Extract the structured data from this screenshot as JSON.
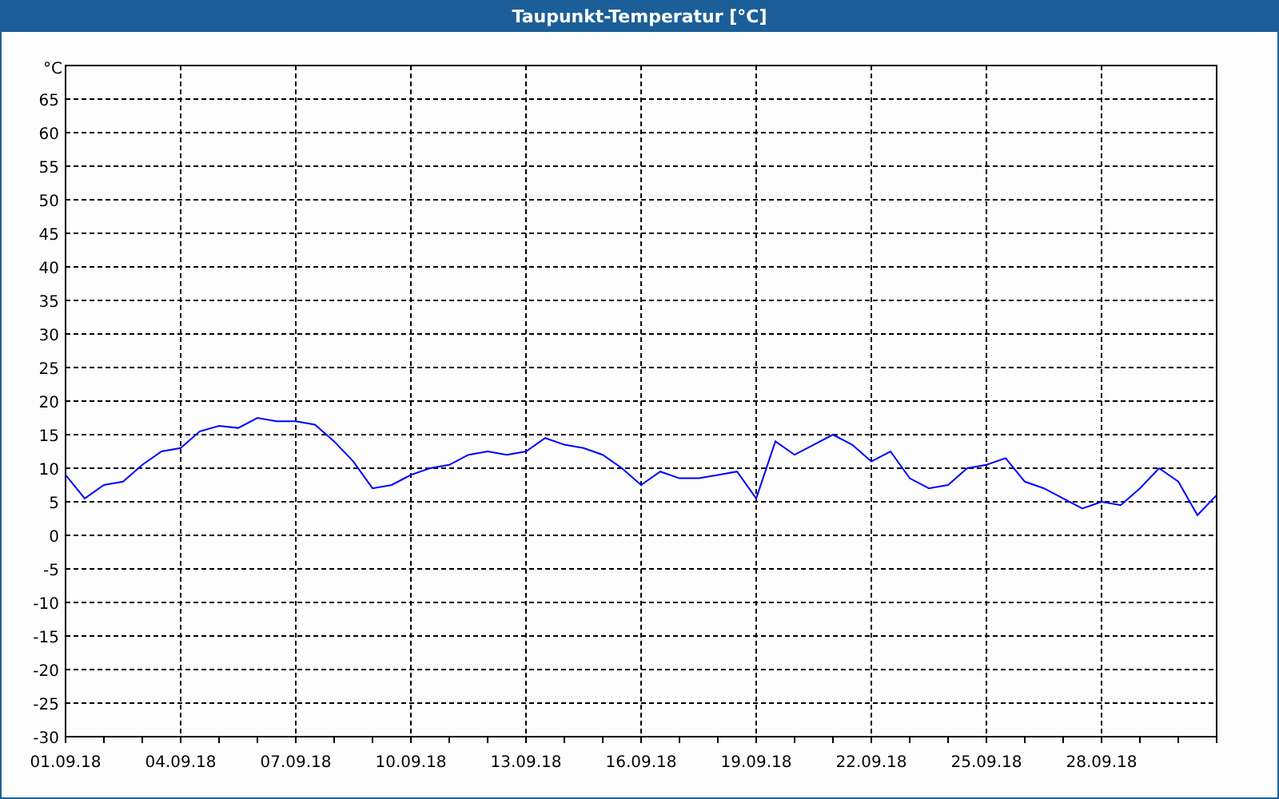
{
  "window": {
    "title": "Taupunkt-Temperatur [°C]"
  },
  "chart": {
    "chart_data": {
      "type": "line",
      "grid": true,
      "ylabel": "°C",
      "ylim": [
        -30,
        70
      ],
      "categories": [
        "01.09.18",
        null,
        null,
        null,
        null,
        null,
        "04.09.18",
        null,
        null,
        null,
        null,
        null,
        "07.09.18",
        null,
        null,
        null,
        null,
        null,
        "10.09.18",
        null,
        null,
        null,
        null,
        null,
        "13.09.18",
        null,
        null,
        null,
        null,
        null,
        "16.09.18",
        null,
        null,
        null,
        null,
        null,
        "19.09.18",
        null,
        null,
        null,
        null,
        null,
        "22.09.18",
        null,
        null,
        null,
        null,
        null,
        "25.09.18",
        null,
        null,
        null,
        null,
        null,
        "28.09.18",
        null,
        null,
        null,
        null,
        null,
        null
      ],
      "series": [
        {
          "color": "#0000ff",
          "values": [
            9,
            5.5,
            7.5,
            8,
            10.5,
            12.5,
            13,
            15.5,
            16.3,
            16,
            17.5,
            17,
            17,
            16.5,
            14,
            11,
            7,
            7.5,
            9,
            10,
            10.5,
            12,
            12.5,
            12,
            12.5,
            14.5,
            13.5,
            13,
            12,
            10,
            7.5,
            9.5,
            8.5,
            8.5,
            9,
            9.5,
            5.5,
            14,
            12,
            13.5,
            15,
            13.5,
            11,
            12.5,
            8.5,
            7,
            7.5,
            10,
            10.5,
            11.5,
            8,
            7,
            5.5,
            4,
            5,
            4.5,
            7,
            10,
            8,
            3,
            6
          ]
        }
      ],
      "yticks": [
        -30,
        -25,
        -20,
        -15,
        -10,
        -5,
        0,
        5,
        10,
        15,
        20,
        25,
        30,
        35,
        40,
        45,
        50,
        55,
        60,
        65
      ]
    }
  }
}
